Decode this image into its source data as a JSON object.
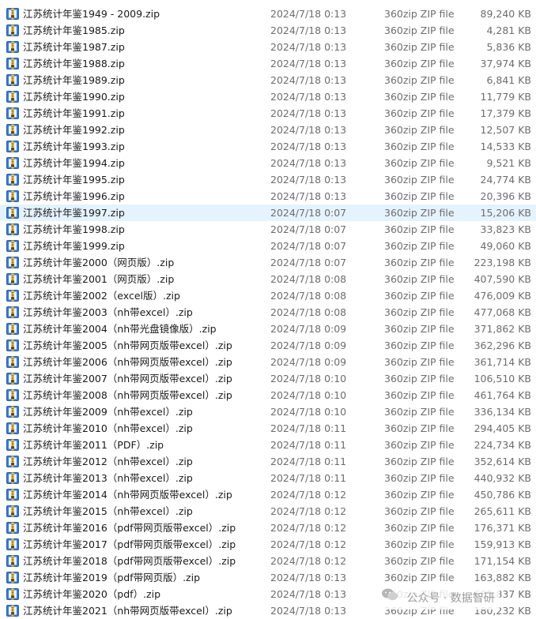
{
  "files": [
    {
      "name": "江苏统计年鉴1949 - 2009.zip",
      "date": "2024/7/18 0:13",
      "type": "360zip ZIP file",
      "size": "89,240 KB"
    },
    {
      "name": "江苏统计年鉴1985.zip",
      "date": "2024/7/18 0:13",
      "type": "360zip ZIP file",
      "size": "4,281 KB"
    },
    {
      "name": "江苏统计年鉴1987.zip",
      "date": "2024/7/18 0:13",
      "type": "360zip ZIP file",
      "size": "5,836 KB"
    },
    {
      "name": "江苏统计年鉴1988.zip",
      "date": "2024/7/18 0:13",
      "type": "360zip ZIP file",
      "size": "37,974 KB"
    },
    {
      "name": "江苏统计年鉴1989.zip",
      "date": "2024/7/18 0:13",
      "type": "360zip ZIP file",
      "size": "6,841 KB"
    },
    {
      "name": "江苏统计年鉴1990.zip",
      "date": "2024/7/18 0:13",
      "type": "360zip ZIP file",
      "size": "11,779 KB"
    },
    {
      "name": "江苏统计年鉴1991.zip",
      "date": "2024/7/18 0:13",
      "type": "360zip ZIP file",
      "size": "17,379 KB"
    },
    {
      "name": "江苏统计年鉴1992.zip",
      "date": "2024/7/18 0:13",
      "type": "360zip ZIP file",
      "size": "12,507 KB"
    },
    {
      "name": "江苏统计年鉴1993.zip",
      "date": "2024/7/18 0:13",
      "type": "360zip ZIP file",
      "size": "14,533 KB"
    },
    {
      "name": "江苏统计年鉴1994.zip",
      "date": "2024/7/18 0:13",
      "type": "360zip ZIP file",
      "size": "9,521 KB"
    },
    {
      "name": "江苏统计年鉴1995.zip",
      "date": "2024/7/18 0:13",
      "type": "360zip ZIP file",
      "size": "24,774 KB"
    },
    {
      "name": "江苏统计年鉴1996.zip",
      "date": "2024/7/18 0:13",
      "type": "360zip ZIP file",
      "size": "20,396 KB"
    },
    {
      "name": "江苏统计年鉴1997.zip",
      "date": "2024/7/18 0:07",
      "type": "360zip ZIP file",
      "size": "15,206 KB",
      "selected": true
    },
    {
      "name": "江苏统计年鉴1998.zip",
      "date": "2024/7/18 0:07",
      "type": "360zip ZIP file",
      "size": "33,823 KB"
    },
    {
      "name": "江苏统计年鉴1999.zip",
      "date": "2024/7/18 0:07",
      "type": "360zip ZIP file",
      "size": "49,060 KB"
    },
    {
      "name": "江苏统计年鉴2000（网页版）.zip",
      "date": "2024/7/18 0:07",
      "type": "360zip ZIP file",
      "size": "223,198 KB"
    },
    {
      "name": "江苏统计年鉴2001（网页版）.zip",
      "date": "2024/7/18 0:08",
      "type": "360zip ZIP file",
      "size": "407,590 KB"
    },
    {
      "name": "江苏统计年鉴2002（excel版）.zip",
      "date": "2024/7/18 0:08",
      "type": "360zip ZIP file",
      "size": "476,009 KB"
    },
    {
      "name": "江苏统计年鉴2003（nh带excel）.zip",
      "date": "2024/7/18 0:08",
      "type": "360zip ZIP file",
      "size": "477,068 KB"
    },
    {
      "name": "江苏统计年鉴2004（nh带光盘镜像版）.zip",
      "date": "2024/7/18 0:09",
      "type": "360zip ZIP file",
      "size": "371,862 KB"
    },
    {
      "name": "江苏统计年鉴2005（nh带网页版带excel）.zip",
      "date": "2024/7/18 0:09",
      "type": "360zip ZIP file",
      "size": "362,296 KB"
    },
    {
      "name": "江苏统计年鉴2006（nh带网页版带excel）.zip",
      "date": "2024/7/18 0:09",
      "type": "360zip ZIP file",
      "size": "361,714 KB"
    },
    {
      "name": "江苏统计年鉴2007（nh带网页版带excel）.zip",
      "date": "2024/7/18 0:10",
      "type": "360zip ZIP file",
      "size": "106,510 KB"
    },
    {
      "name": "江苏统计年鉴2008（nh带网页版带excel）.zip",
      "date": "2024/7/18 0:10",
      "type": "360zip ZIP file",
      "size": "461,764 KB"
    },
    {
      "name": "江苏统计年鉴2009（nh带excel）.zip",
      "date": "2024/7/18 0:10",
      "type": "360zip ZIP file",
      "size": "336,134 KB"
    },
    {
      "name": "江苏统计年鉴2010（nh带excel）.zip",
      "date": "2024/7/18 0:11",
      "type": "360zip ZIP file",
      "size": "294,405 KB"
    },
    {
      "name": "江苏统计年鉴2011（PDF）.zip",
      "date": "2024/7/18 0:11",
      "type": "360zip ZIP file",
      "size": "224,734 KB"
    },
    {
      "name": "江苏统计年鉴2012（nh带excel）.zip",
      "date": "2024/7/18 0:11",
      "type": "360zip ZIP file",
      "size": "352,614 KB"
    },
    {
      "name": "江苏统计年鉴2013（nh带excel）.zip",
      "date": "2024/7/18 0:11",
      "type": "360zip ZIP file",
      "size": "440,932 KB"
    },
    {
      "name": "江苏统计年鉴2014（nh带网页版带excel）.zip",
      "date": "2024/7/18 0:12",
      "type": "360zip ZIP file",
      "size": "450,786 KB"
    },
    {
      "name": "江苏统计年鉴2015（nh带excel）.zip",
      "date": "2024/7/18 0:12",
      "type": "360zip ZIP file",
      "size": "265,611 KB"
    },
    {
      "name": "江苏统计年鉴2016（pdf带网页版带excel）.zip",
      "date": "2024/7/18 0:12",
      "type": "360zip ZIP file",
      "size": "176,371 KB"
    },
    {
      "name": "江苏统计年鉴2017（pdf带网页版带excel）.zip",
      "date": "2024/7/18 0:12",
      "type": "360zip ZIP file",
      "size": "159,913 KB"
    },
    {
      "name": "江苏统计年鉴2018（pdf带网页版带excel）.zip",
      "date": "2024/7/18 0:12",
      "type": "360zip ZIP file",
      "size": "171,154 KB"
    },
    {
      "name": "江苏统计年鉴2019（pdf带网页版）.zip",
      "date": "2024/7/18 0:13",
      "type": "360zip ZIP file",
      "size": "163,882 KB"
    },
    {
      "name": "江苏统计年鉴2020（pdf）.zip",
      "date": "2024/7/18 0:13",
      "type": "360zip ZIP file",
      "size": "685,837 KB"
    },
    {
      "name": "江苏统计年鉴2021（nh带网页版带excel）.zip",
      "date": "2024/7/18 0:13",
      "type": "360zip ZIP file",
      "size": "180,232 KB"
    }
  ],
  "watermark": {
    "text": "公众号 · 数据智研",
    "icon": "wechat-icon"
  },
  "colors": {
    "selection": "#e5f3ff",
    "name_text": "#1a1a1a",
    "meta_text": "#6d6d6d",
    "zip_icon_blue": "#3a7bd5",
    "zip_icon_yellow": "#f2c431"
  }
}
